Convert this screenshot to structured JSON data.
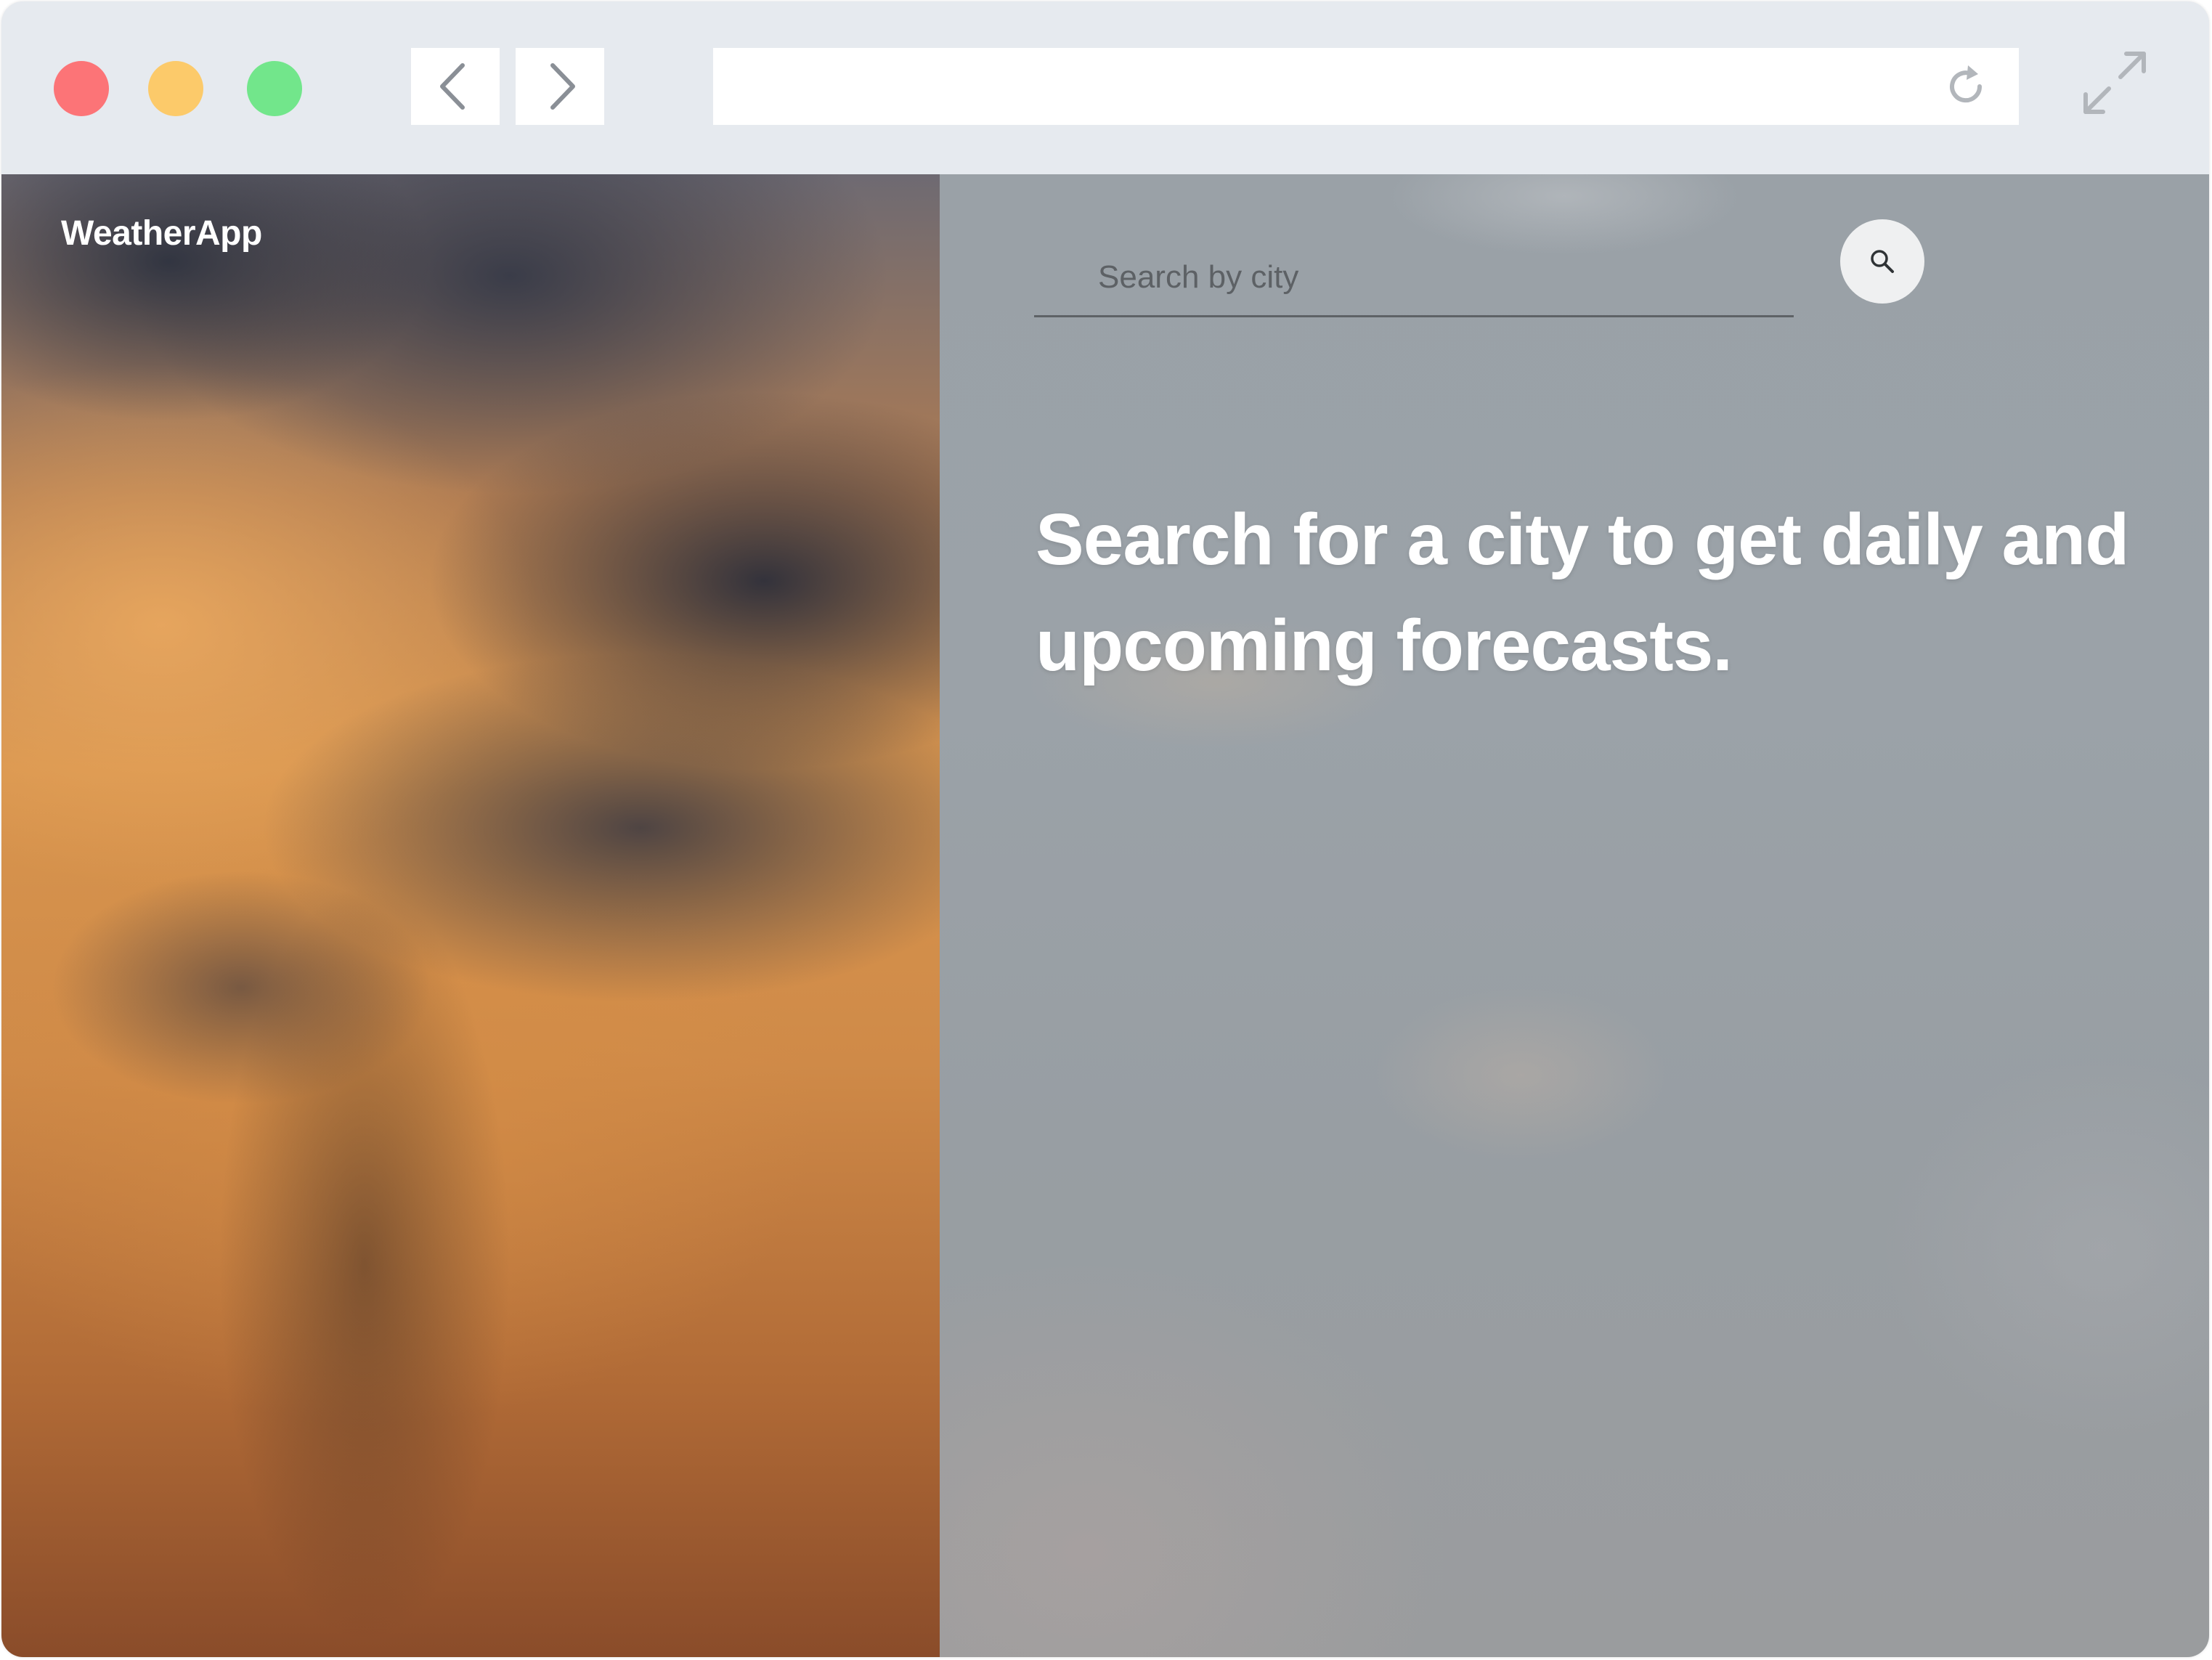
{
  "window": {
    "controls": {
      "close_color": "#fc7477",
      "minimize_color": "#fcca6a",
      "maximize_color": "#72e68b"
    },
    "nav": {
      "back_icon": "chevron-left-icon",
      "forward_icon": "chevron-right-icon"
    },
    "address_bar": {
      "value": "",
      "reload_icon": "reload-icon"
    },
    "expand_icon": "expand-icon"
  },
  "app": {
    "brand": "WeatherApp",
    "search": {
      "placeholder": "Search by city",
      "value": "",
      "button_icon": "search-icon"
    },
    "headline": "Search for a city to get daily and upcoming forecasts."
  }
}
